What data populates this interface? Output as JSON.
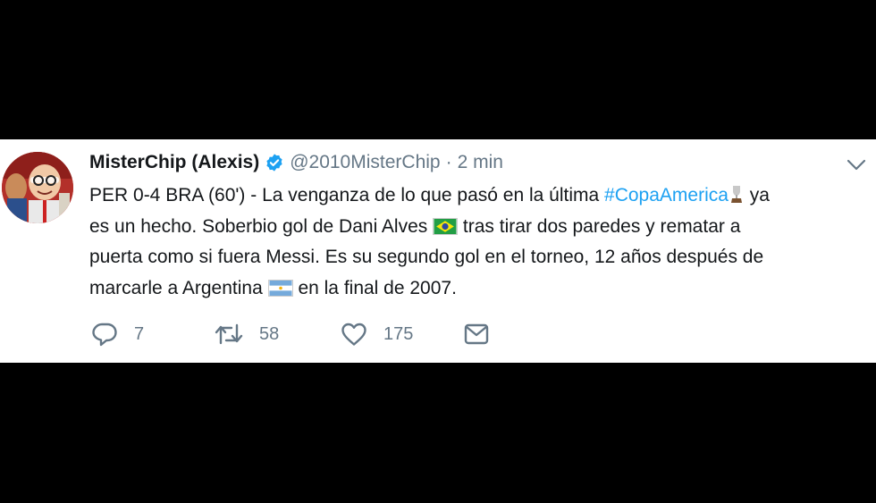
{
  "tweet": {
    "display_name": "MisterChip (Alexis)",
    "handle": "@2010MisterChip",
    "separator": "·",
    "time": "2 min",
    "text": {
      "line1_a": "PER 0-4 BRA (60') - La venganza de lo que pasó en la última ",
      "hashtag": "#CopaAmerica",
      "line1_b": " ya",
      "line2_a": "es un hecho. Soberbio gol de Dani Alves ",
      "line2_b": " tras tirar dos paredes y rematar a",
      "line3": "puerta como si fuera Messi. Es su segundo gol en el torneo, 12 años después de",
      "line4_a": "marcarle a Argentina ",
      "line4_b": " en la final de 2007."
    },
    "actions": {
      "replies": "7",
      "retweets": "58",
      "likes": "175"
    }
  },
  "colors": {
    "link": "#1da1f2",
    "muted": "#657786",
    "text": "#14171a",
    "verified": "#1da1f2"
  },
  "icons": [
    "verified-badge-icon",
    "chevron-down-icon",
    "trophy-emoji-icon",
    "brazil-flag-icon",
    "argentina-flag-icon",
    "reply-icon",
    "retweet-icon",
    "like-icon",
    "direct-message-icon"
  ]
}
